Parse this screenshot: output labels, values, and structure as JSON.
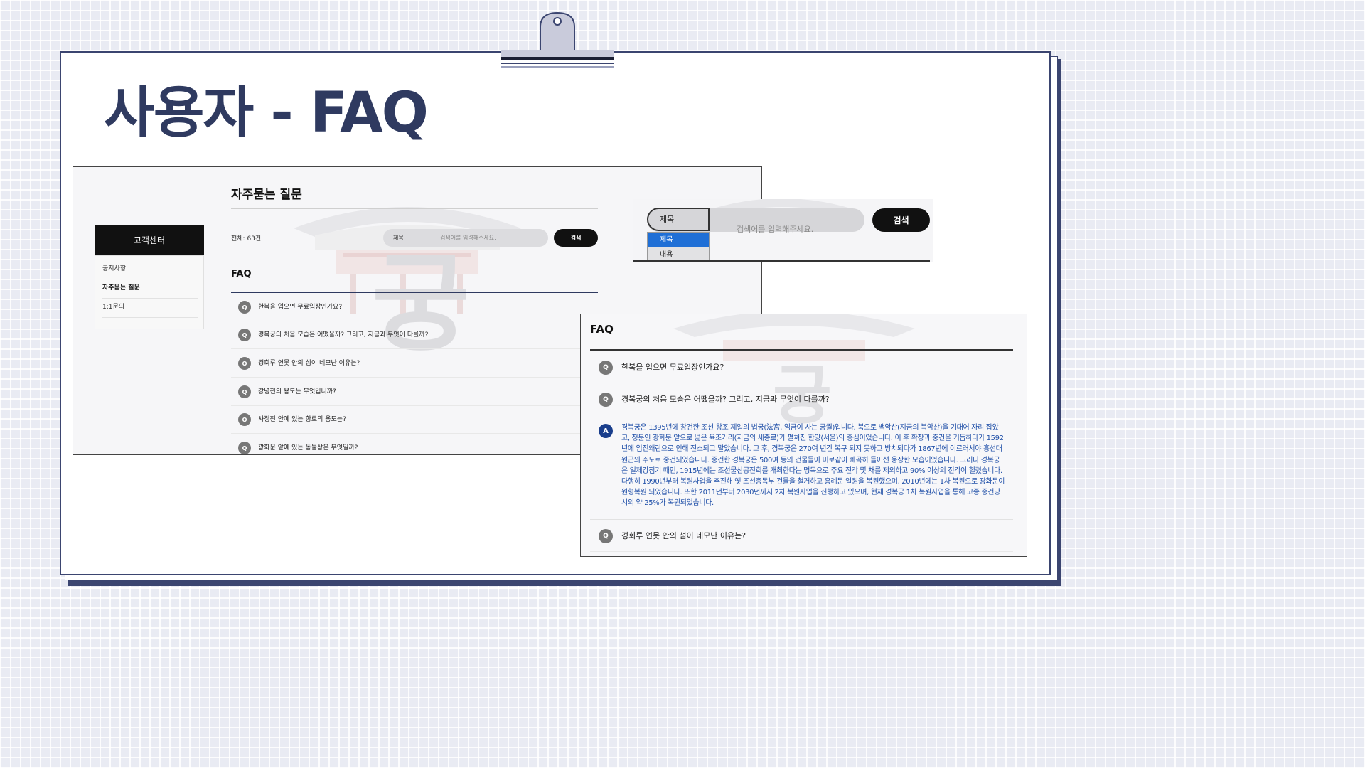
{
  "slide": {
    "title": "사용자 - FAQ"
  },
  "left_screen": {
    "heading": "자주묻는 질문",
    "sidebar": {
      "title": "고객센터",
      "items": [
        {
          "label": "공지사항",
          "active": false
        },
        {
          "label": "자주묻는 질문",
          "active": true
        },
        {
          "label": "1:1문의",
          "active": false
        }
      ]
    },
    "total_count": "전체: 63건",
    "search": {
      "select_value": "제목",
      "placeholder": "검색어를 입력해주세요.",
      "button": "검색"
    },
    "faq_title": "FAQ",
    "questions": [
      {
        "badge": "Q",
        "text": "한복을 입으면 무료입장인가요?"
      },
      {
        "badge": "Q",
        "text": "경복궁의 처음 모습은 어땠을까? 그리고, 지금과 무엇이 다를까?"
      },
      {
        "badge": "Q",
        "text": "경회루 연못 안의 섬이 네모난 이유는?"
      },
      {
        "badge": "Q",
        "text": "강녕전의 용도는 무엇입니까?"
      },
      {
        "badge": "Q",
        "text": "사정전 안에 있는 향로의 용도는?"
      },
      {
        "badge": "Q",
        "text": "광화문 앞에 있는 동물상은 무엇일까?"
      }
    ]
  },
  "search_dropdown": {
    "select_value": "제목",
    "placeholder": "검색어를 입력해주세요.",
    "button": "검색",
    "options": [
      {
        "label": "제목",
        "selected": true
      },
      {
        "label": "내용",
        "selected": false
      }
    ]
  },
  "faq_detail": {
    "title": "FAQ",
    "questions": [
      {
        "badge": "Q",
        "text": "한복을 입으면 무료입장인가요?"
      },
      {
        "badge": "Q",
        "text": "경복궁의 처음 모습은 어땠을까? 그리고, 지금과 무엇이 다를까?"
      }
    ],
    "answer": {
      "badge": "A",
      "text": "경복궁은 1395년에 창건한 조선 왕조 제일의 법궁(法宮, 임금이 사는 궁궐)입니다. 북으로 백악산(지금의 북악산)을 기대어 자리 잡았고, 정문인 광화문 앞으로 넓은 육조거리(지금의 세종로)가 펼쳐진 한양(서울)의 중심이었습니다. 이 후 확장과 중건을 거듭하다가 1592년에 임진왜란으로 인해 전소되고 말았습니다. 그 후, 경복궁은 270여 년간 복구 되지 못하고 방치되다가 1867년에 이르러서야 흥선대원군의 주도로 중건되었습니다. 중건한 경복궁은 500여 동의 건물들이 미로같이 빼곡히 들어선 웅장한 모습이었습니다. 그러나 경복궁은 일제강점기 때인, 1915년에는 조선물산공진회를 개최한다는 명목으로 주요 전각 몇 채를 제외하고 90% 이상의 전각이 헐렸습니다. 다행히 1990년부터 복원사업을 추진해 옛 조선총독부 건물을 철거하고 흥례문 일원을 복원했으며, 2010년에는 1차 복원으로 광화문이 원형복원 되었습니다. 또한 2011년부터 2030년까지 2차 복원사업을 진행하고 있으며, 현재 경복궁 1차 복원사업을 통해 고종 중건당시의 약 25%가 복원되었습니다."
    },
    "last_question": {
      "badge": "Q",
      "text": "경회루 연못 안의 섬이 네모난 이유는?"
    }
  },
  "watermark_glyph": "궁",
  "colors": {
    "navy": "#2f3a60",
    "answer_blue": "#1f4fa8",
    "dropdown_selected": "#1f6fd6",
    "button_black": "#111111"
  }
}
